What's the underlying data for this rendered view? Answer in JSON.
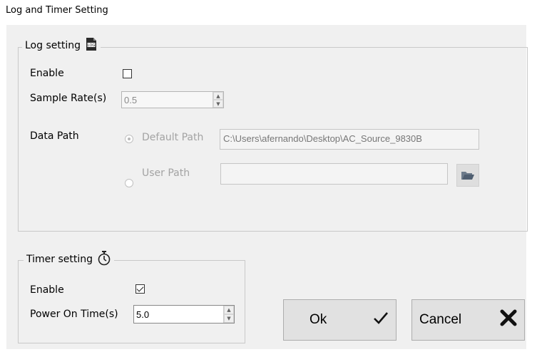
{
  "window": {
    "title": "Log and Timer Setting"
  },
  "log_setting": {
    "legend": "Log setting",
    "icon": "log-file-icon",
    "enable_label": "Enable",
    "enable_checked": false,
    "sample_rate_label": "Sample Rate(s)",
    "sample_rate_value": "0.5",
    "data_path_label": "Data Path",
    "default_path_label": "Default Path",
    "default_path_value": "C:\\Users\\afernando\\Desktop\\AC_Source_9830B",
    "user_path_label": "User Path",
    "user_path_value": "",
    "selected_path": "default",
    "browse_icon": "folder-open-icon"
  },
  "timer_setting": {
    "legend": "Timer setting",
    "icon": "stopwatch-icon",
    "enable_label": "Enable",
    "enable_checked": true,
    "power_on_label": "Power On Time(s)",
    "power_on_value": "5.0"
  },
  "buttons": {
    "ok_label": "Ok",
    "ok_icon": "checkmark-icon",
    "cancel_label": "Cancel",
    "cancel_icon": "x-icon"
  }
}
